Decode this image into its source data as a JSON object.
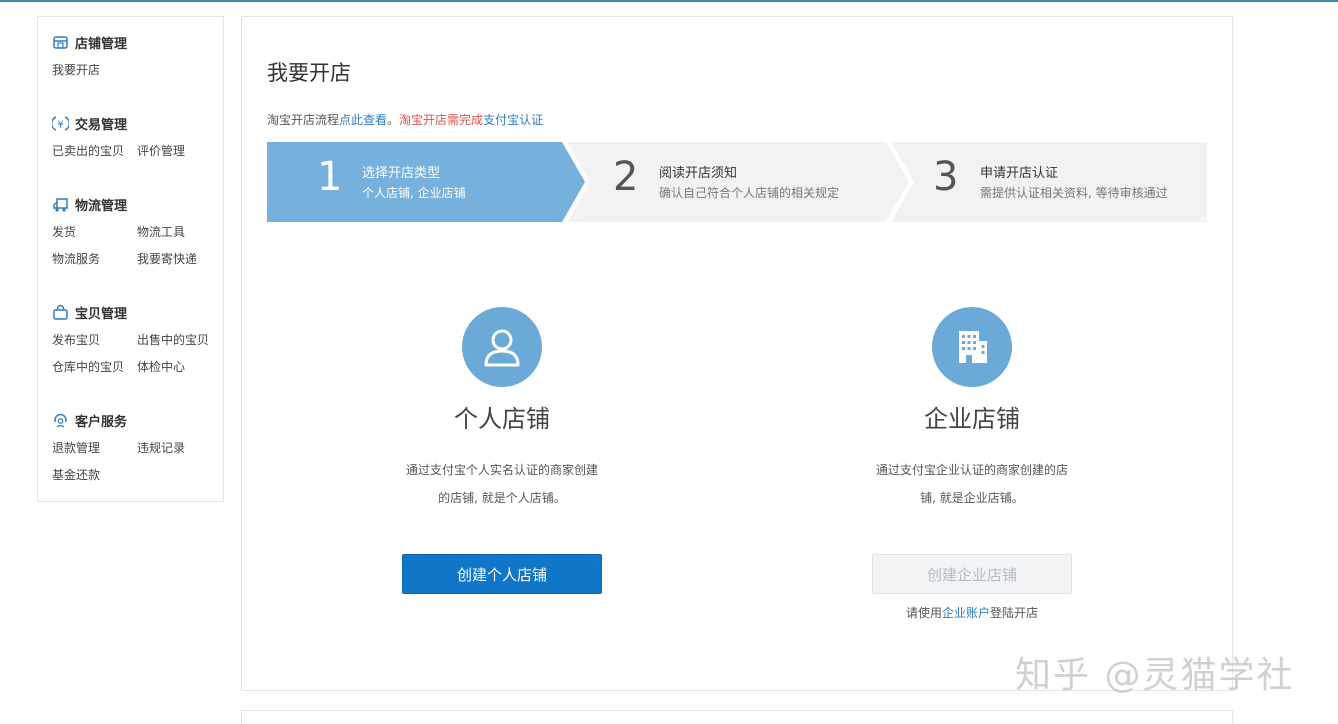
{
  "sidebar": {
    "sections": [
      {
        "title": "店铺管理",
        "icon": "store-icon",
        "links": [
          "我要开店"
        ]
      },
      {
        "title": "交易管理",
        "icon": "yuan-icon",
        "links": [
          "已卖出的宝贝",
          "评价管理"
        ]
      },
      {
        "title": "物流管理",
        "icon": "truck-icon",
        "links": [
          "发货",
          "物流工具",
          "物流服务",
          "我要寄快递"
        ]
      },
      {
        "title": "宝贝管理",
        "icon": "bag-icon",
        "links": [
          "发布宝贝",
          "出售中的宝贝",
          "仓库中的宝贝",
          "体检中心"
        ]
      },
      {
        "title": "客户服务",
        "icon": "headset-icon",
        "links": [
          "退款管理",
          "违规记录",
          "基金还款"
        ]
      }
    ]
  },
  "main": {
    "title": "我要开店",
    "notice": {
      "prefix": "淘宝开店流程",
      "link1": "点此查看",
      "sep": "。",
      "warn": "淘宝开店需完成",
      "link2": "支付宝认证"
    },
    "steps": [
      {
        "num": "1",
        "title": "选择开店类型",
        "sub": "个人店铺, 企业店铺",
        "active": true
      },
      {
        "num": "2",
        "title": "阅读开店须知",
        "sub": "确认自己符合个人店铺的相关规定",
        "active": false
      },
      {
        "num": "3",
        "title": "申请开店认证",
        "sub": "需提供认证相关资料, 等待审核通过",
        "active": false
      }
    ],
    "personal": {
      "icon": "user-icon",
      "name": "个人店铺",
      "desc_line1": "通过支付宝个人实名认证的商家创建",
      "desc_line2": "的店铺, 就是个人店铺。",
      "button": "创建个人店铺"
    },
    "enterprise": {
      "icon": "building-icon",
      "name": "企业店铺",
      "desc_line1": "通过支付宝企业认证的商家创建的店",
      "desc_line2": "铺, 就是企业店铺。",
      "button": "创建企业店铺",
      "hint_prefix": "请使用",
      "hint_link": "企业账户",
      "hint_suffix": "登陆开店"
    }
  },
  "watermark": "知乎 @灵猫学社",
  "colors": {
    "accent": "#1176c8",
    "step_active": "#76b0dc",
    "step_inactive": "#f2f2f5",
    "icon_circle": "#6aa9d8"
  }
}
